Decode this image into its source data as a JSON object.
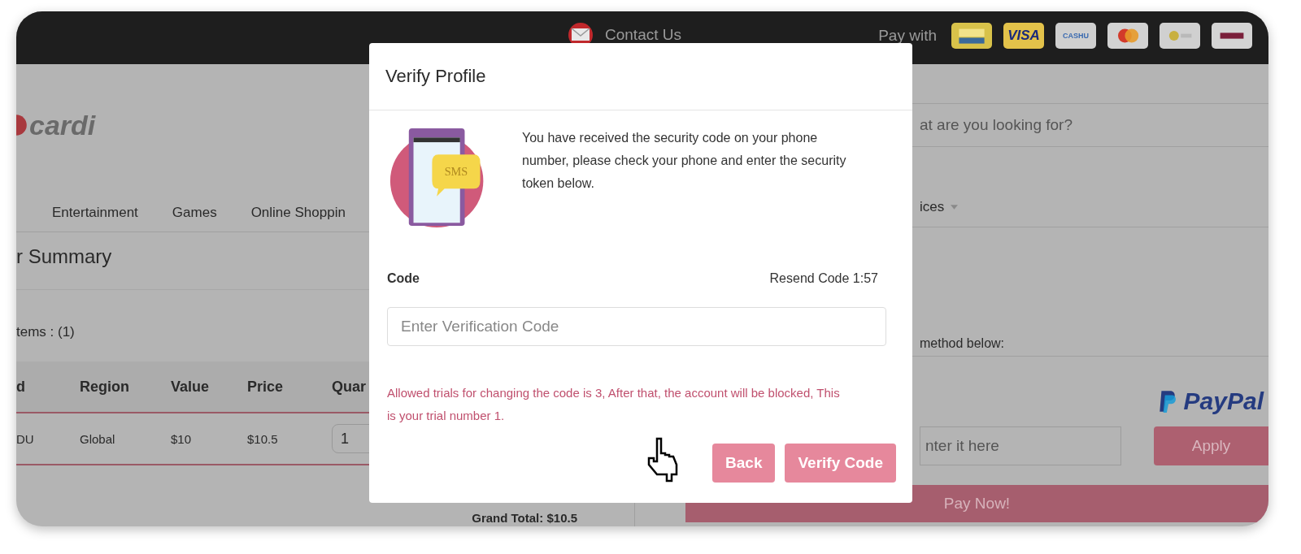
{
  "top_bar": {
    "contact": "Contact Us",
    "pay_with": "Pay with",
    "payment_logos": [
      {
        "kind": "wallet"
      },
      {
        "kind": "visa",
        "label": "VISA"
      },
      {
        "kind": "cashu",
        "label": "CASHU"
      },
      {
        "kind": "mastercard"
      },
      {
        "kind": "gold"
      },
      {
        "kind": "bill"
      }
    ]
  },
  "logo": "cardi",
  "search": {
    "placeholder": "at are you looking for?"
  },
  "nav": [
    {
      "label": "Entertainment",
      "dropdown": false
    },
    {
      "label": "Games",
      "dropdown": false
    },
    {
      "label": "Online Shoppin",
      "dropdown": false
    },
    {
      "label": "ices",
      "dropdown": true
    }
  ],
  "order": {
    "title": "r Summary",
    "items": "tems : (1)",
    "columns": [
      "d",
      "Region",
      "Value",
      "Price",
      "Quar"
    ],
    "rows": [
      {
        "cells": [
          "DU",
          "Global",
          "$10",
          "$10.5"
        ],
        "quantity": "1"
      }
    ],
    "grand_total": "Grand Total: $10.5"
  },
  "payment": {
    "instruction": "method below:",
    "paypal": "PayPal",
    "coupon": {
      "placeholder": "nter it here"
    },
    "apply": "Apply",
    "pay_now": "Pay Now!"
  },
  "modal": {
    "title": "Verify Profile",
    "message": "You have received the security code on your phone number, please check your phone and enter the security token below.",
    "badge": "SMS",
    "code_label": "Code",
    "resend": "Resend Code 1:57",
    "input": {
      "placeholder": "Enter Verification Code"
    },
    "error": "Allowed trials for changing the code is 3, After that, the account will be blocked, This is your trial number 1.",
    "buttons": [
      "Back",
      "Verify Code"
    ]
  }
}
